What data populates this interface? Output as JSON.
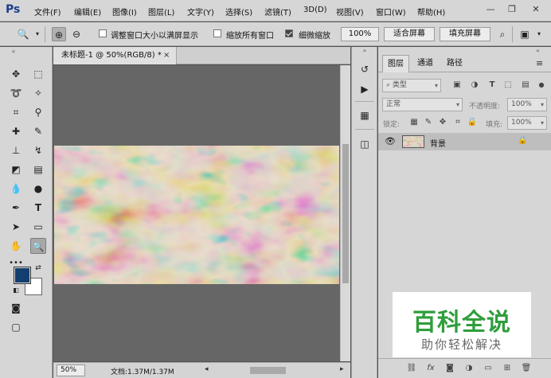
{
  "app": {
    "logo": "Ps"
  },
  "menu": {
    "items": [
      "文件(F)",
      "编辑(E)",
      "图像(I)",
      "图层(L)",
      "文字(Y)",
      "选择(S)",
      "滤镜(T)",
      "3D(D)",
      "视图(V)",
      "窗口(W)",
      "帮助(H)"
    ]
  },
  "window_controls": {
    "minimize": "—",
    "restore": "❐",
    "close": "✕"
  },
  "options": {
    "resize_windows_label": "调整窗口大小以满屏显示",
    "zoom_all_label": "缩放所有窗口",
    "scrubby_zoom_label": "细微缩放",
    "zoom_value": "100%",
    "fit_screen": "适合屏幕",
    "fill_screen": "填充屏幕",
    "resize_windows_checked": false,
    "zoom_all_checked": false,
    "scrubby_zoom_checked": true
  },
  "document": {
    "tab_title": "未标题-1 @ 50%(RGB/8) *",
    "close": "×",
    "status_zoom": "50%",
    "doc_info": "文档:1.37M/1.37M",
    "arrow_right": "▸",
    "hscroll_left": "◂",
    "hscroll_right": "▸"
  },
  "layers_panel": {
    "tabs": [
      "图层",
      "通道",
      "路径"
    ],
    "active_tab": 0,
    "filter_kind": "类型",
    "blend_mode": "正常",
    "opacity_label": "不透明度:",
    "opacity_value": "100%",
    "lock_label": "锁定:",
    "fill_label": "填充:",
    "fill_value": "100%",
    "layer": {
      "name": "背景",
      "visible": true,
      "locked": true
    }
  },
  "colors": {
    "foreground": "#123e70",
    "background": "#ffffff",
    "accent": "#1d3f8a"
  },
  "watermark": {
    "title": "百科全说",
    "subtitle": "助你轻松解决"
  }
}
